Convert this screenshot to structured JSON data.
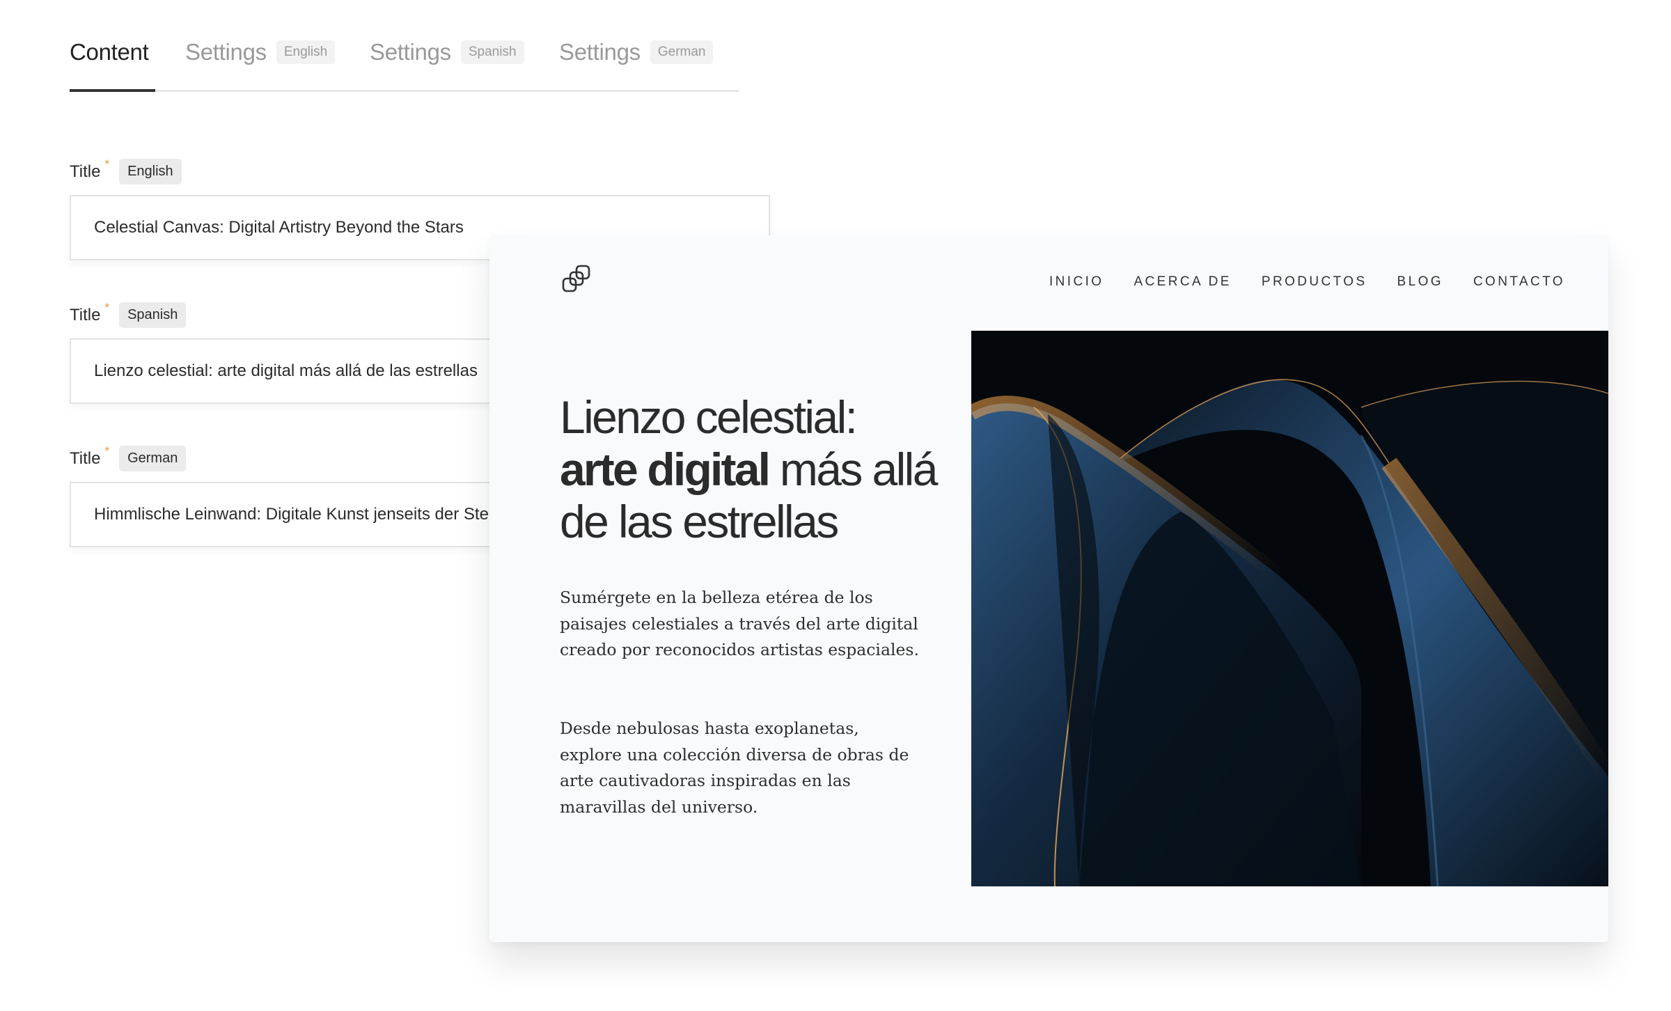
{
  "tabs": [
    {
      "label": "Content",
      "badge": null,
      "active": true
    },
    {
      "label": "Settings",
      "badge": "English",
      "active": false
    },
    {
      "label": "Settings",
      "badge": "Spanish",
      "active": false
    },
    {
      "label": "Settings",
      "badge": "German",
      "active": false
    }
  ],
  "fields": [
    {
      "label": "Title",
      "required_mark": "*",
      "language": "English",
      "value": "Celestial Canvas: Digital Artistry Beyond the Stars"
    },
    {
      "label": "Title",
      "required_mark": "*",
      "language": "Spanish",
      "value": "Lienzo celestial: arte digital más allá de las estrellas"
    },
    {
      "label": "Title",
      "required_mark": "*",
      "language": "German",
      "value": "Himmlische Leinwand: Digitale Kunst jenseits der Sterne"
    }
  ],
  "preview": {
    "logo_icon": "interlinked-squares-icon",
    "nav": [
      "INICIO",
      "ACERCA DE",
      "PRODUCTOS",
      "BLOG",
      "CONTACTO"
    ],
    "headline": {
      "line1": "Lienzo celestial:",
      "bold": "arte digital",
      "rest": " más allá de las estrellas"
    },
    "paragraphs": [
      "Sumérgete en la belleza etérea de los paisajes celestiales a través del arte digital creado por reconocidos artistas espaciales.",
      "Desde nebulosas hasta exoplanetas, explore una colección diversa de obras de arte cautivadoras inspiradas en las maravillas del universo."
    ],
    "hero_image": "abstract-dark-blue-curves-with-orange-rim-light"
  },
  "colors": {
    "required": "#e8943a",
    "active_tab": "#222222",
    "inactive_tab": "#999999",
    "card_bg": "#f9fafc",
    "hero_bg": "#04080c",
    "hero_blue": "#2f5a85",
    "hero_orange": "#f0a24a"
  }
}
